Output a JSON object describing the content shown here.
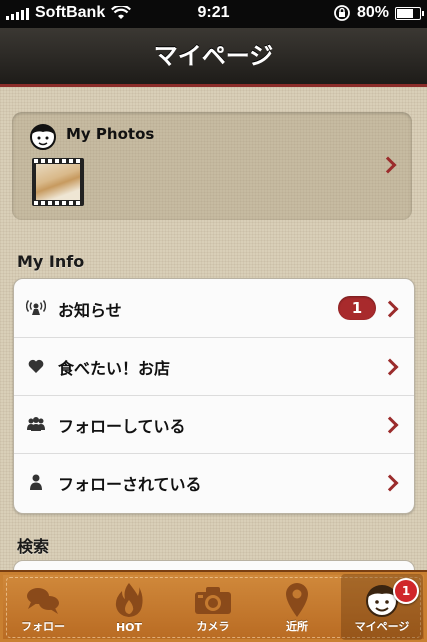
{
  "status_bar": {
    "carrier": "SoftBank",
    "time": "9:21",
    "battery": "80%",
    "battery_level": 0.8,
    "icons": [
      "signal-icon",
      "wifi-icon",
      "rotation-lock-icon",
      "battery-icon"
    ]
  },
  "navbar": {
    "title": "マイページ"
  },
  "my_photos": {
    "label": "My Photos"
  },
  "my_info": {
    "header": "My Info",
    "rows": [
      {
        "label": "お知らせ",
        "icon": "broadcast-icon",
        "badge": "1"
      },
      {
        "label": "食べたい！お店",
        "icon": "heart-icon"
      },
      {
        "label": "フォローしている",
        "icon": "users-icon"
      },
      {
        "label": "フォローされている",
        "icon": "user-icon"
      }
    ]
  },
  "search": {
    "header": "検索"
  },
  "tabbar": {
    "tabs": [
      {
        "label": "フォロー",
        "icon": "chat-bubbles-icon"
      },
      {
        "label": "HOT",
        "icon": "flame-icon"
      },
      {
        "label": "カメラ",
        "icon": "camera-icon"
      },
      {
        "label": "近所",
        "icon": "map-pin-icon"
      },
      {
        "label": "マイページ",
        "icon": "face-icon",
        "badge": "1",
        "active": true
      }
    ]
  },
  "colors": {
    "accent": "#9b2c2c",
    "tabbar": "#c47a30",
    "navbar": "#2b2926"
  }
}
